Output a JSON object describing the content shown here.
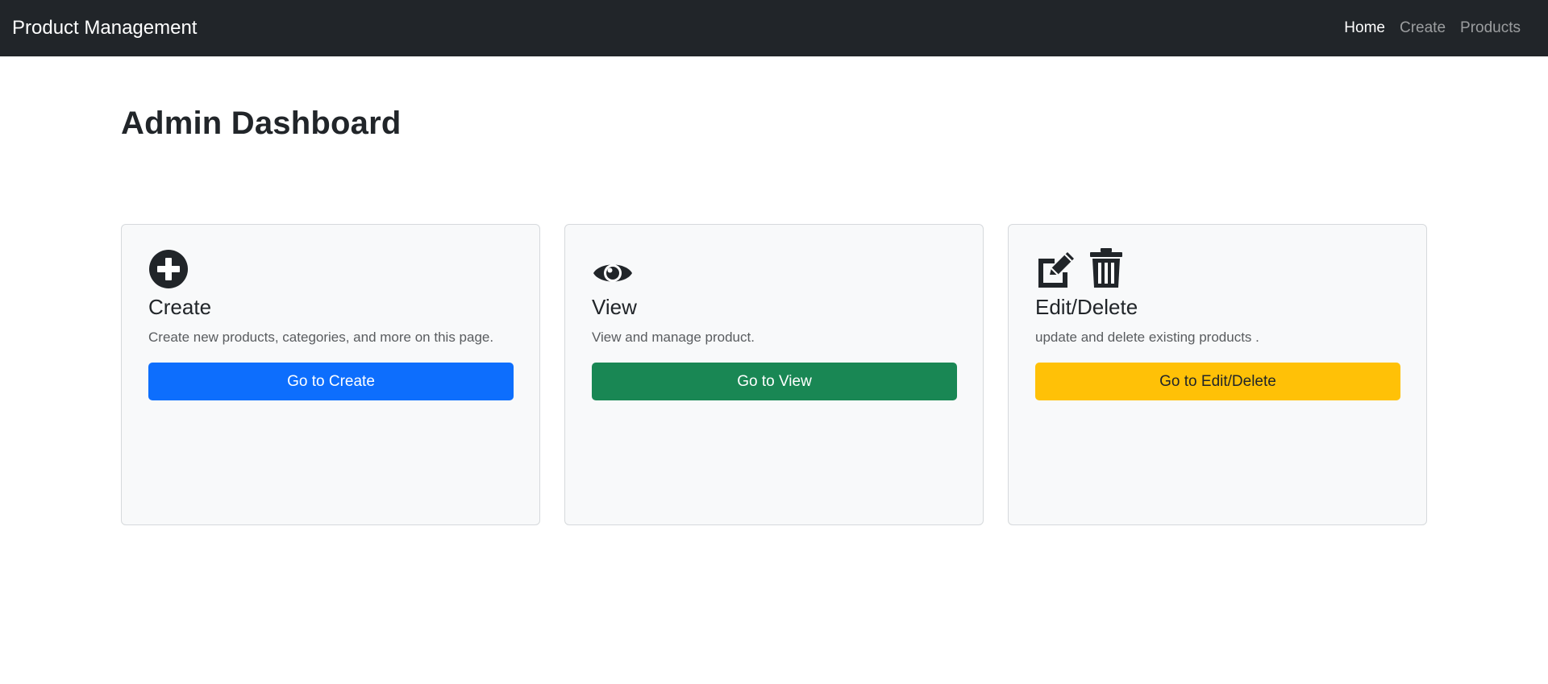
{
  "navbar": {
    "brand": "Product Management",
    "links": [
      {
        "label": "Home",
        "active": true
      },
      {
        "label": "Create",
        "active": false
      },
      {
        "label": "Products",
        "active": false
      }
    ]
  },
  "page": {
    "title": "Admin Dashboard"
  },
  "cards": [
    {
      "icons": [
        "plus-circle-icon"
      ],
      "title": "Create",
      "text": "Create new products, categories, and more on this page.",
      "button": "Go to Create",
      "button_color": "#0d6efd"
    },
    {
      "icons": [
        "eye-icon"
      ],
      "title": "View",
      "text": "View and manage product.",
      "button": "Go to View",
      "button_color": "#198754"
    },
    {
      "icons": [
        "edit-icon",
        "trash-icon"
      ],
      "title": "Edit/Delete",
      "text": "update and delete existing products .",
      "button": "Go to Edit/Delete",
      "button_color": "#ffc107"
    }
  ],
  "colors": {
    "navbar_bg": "#212529",
    "card_bg": "#f8f9fa"
  }
}
